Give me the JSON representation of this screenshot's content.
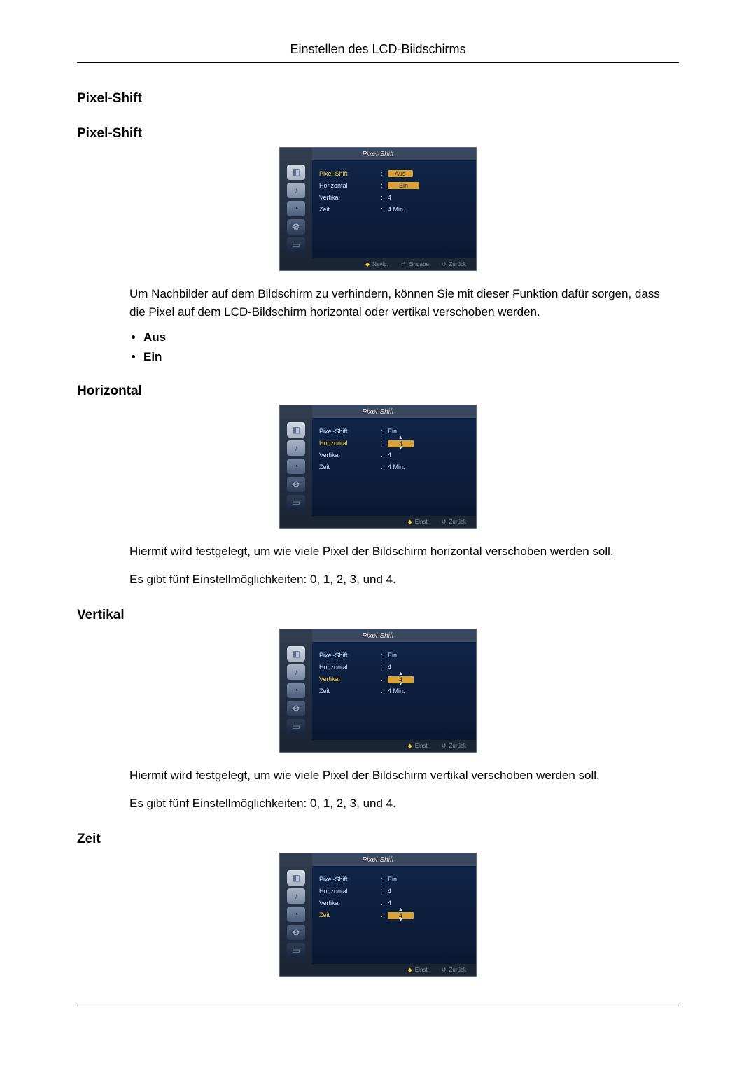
{
  "doc": {
    "title": "Einstellen des LCD-Bildschirms"
  },
  "sections": {
    "pixel_shift_main": "Pixel-Shift",
    "pixel_shift_sub": "Pixel-Shift",
    "horizontal": "Horizontal",
    "vertikal": "Vertikal",
    "zeit": "Zeit"
  },
  "text": {
    "ps_desc": "Um Nachbilder auf dem Bildschirm zu verhindern, können Sie mit dieser Funktion dafür sorgen, dass die Pixel auf dem LCD-Bildschirm horizontal oder vertikal verschoben werden.",
    "h_desc1": "Hiermit wird festgelegt, um wie viele Pixel der Bildschirm horizontal verschoben werden soll.",
    "h_desc2": "Es gibt fünf Einstellmöglichkeiten: 0, 1, 2, 3, und 4.",
    "v_desc1": "Hiermit wird festgelegt, um wie viele Pixel der Bildschirm vertikal verschoben werden soll.",
    "v_desc2": "Es gibt fünf Einstellmöglichkeiten: 0, 1, 2, 3, und 4."
  },
  "options": {
    "aus": "Aus",
    "ein": "Ein"
  },
  "osd": {
    "title": "Pixel-Shift",
    "labels": {
      "pixel_shift": "Pixel-Shift",
      "horizontal": "Horizontal",
      "vertikal": "Vertikal",
      "zeit": "Zeit"
    },
    "values": {
      "aus": "Aus",
      "ein": "Ein",
      "four": "4",
      "four_min": "4 Min."
    },
    "footer": {
      "navig": "Navig.",
      "eingabe": "Eingabe",
      "zurueck": "Zurück",
      "einst": "Einst."
    }
  }
}
